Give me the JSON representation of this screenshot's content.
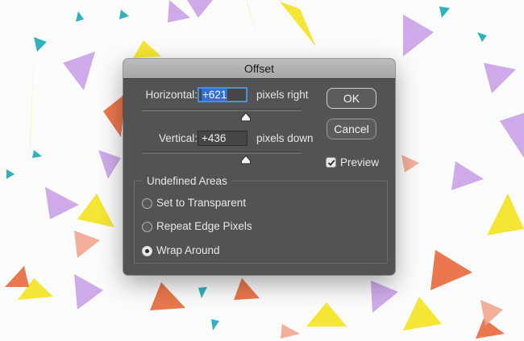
{
  "dialog": {
    "title": "Offset",
    "horizontal": {
      "label": "Horizontal:",
      "value": "+621",
      "unit": "pixels right"
    },
    "vertical": {
      "label": "Vertical:",
      "value": "+436",
      "unit": "pixels down"
    },
    "ok_label": "OK",
    "cancel_label": "Cancel",
    "preview": {
      "label": "Preview",
      "checked": true
    },
    "undefined_areas": {
      "title": "Undefined Areas",
      "options": [
        {
          "label": "Set to Transparent",
          "selected": false
        },
        {
          "label": "Repeat Edge Pixels",
          "selected": false
        },
        {
          "label": "Wrap Around",
          "selected": true
        }
      ]
    }
  },
  "colors": {
    "dialog_bg": "#535353",
    "focus_ring": "#4a8fe0",
    "pattern": [
      "#f4e21f",
      "#e8683a",
      "#c9a2e6",
      "#1ba9b8",
      "#f2a58e"
    ]
  },
  "icons": [
    "checkmark-icon",
    "slider-thumb-icon",
    "triangle-shape"
  ]
}
